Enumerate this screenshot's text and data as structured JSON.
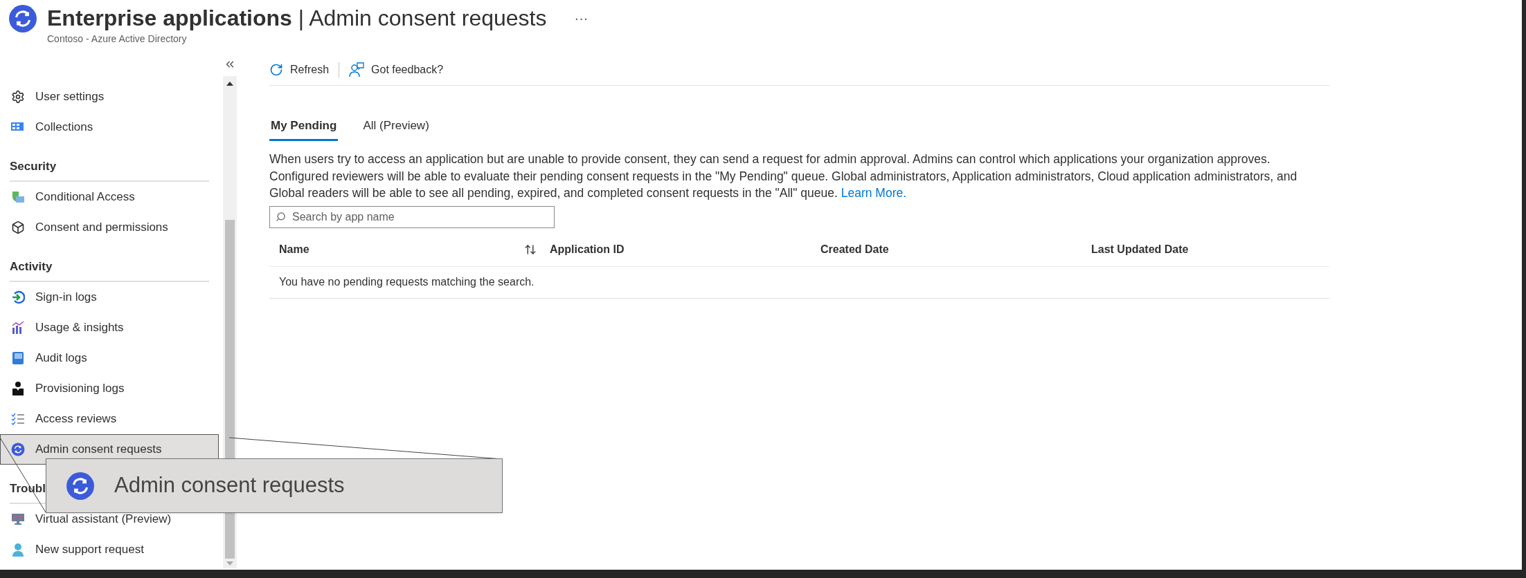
{
  "header": {
    "title": "Enterprise applications",
    "separator": "|",
    "page": "Admin consent requests",
    "org": "Contoso - Azure Active Directory",
    "more": "···"
  },
  "sidebar": {
    "sections": [
      {
        "items": [
          {
            "label": "User settings",
            "selected": false
          },
          {
            "label": "Collections",
            "selected": false
          }
        ]
      },
      {
        "heading": "Security",
        "items": [
          {
            "label": "Conditional Access",
            "selected": false
          },
          {
            "label": "Consent and permissions",
            "selected": false
          }
        ]
      },
      {
        "heading": "Activity",
        "items": [
          {
            "label": "Sign-in logs",
            "selected": false
          },
          {
            "label": "Usage & insights",
            "selected": false
          },
          {
            "label": "Audit logs",
            "selected": false
          },
          {
            "label": "Provisioning logs",
            "selected": false
          },
          {
            "label": "Access reviews",
            "selected": false
          },
          {
            "label": "Admin consent requests",
            "selected": true
          }
        ]
      },
      {
        "heading": "Troubl",
        "items": [
          {
            "label": "Virtual assistant (Preview)",
            "selected": false
          },
          {
            "label": "New support request",
            "selected": false
          }
        ]
      }
    ]
  },
  "zoom_callout": {
    "label": "Admin consent requests"
  },
  "toolbar": [
    {
      "label": "Refresh"
    },
    {
      "label": "Got feedback?"
    }
  ],
  "tabs": [
    {
      "label": "My Pending",
      "selected": true
    },
    {
      "label": "All (Preview)",
      "selected": false
    }
  ],
  "description": {
    "text": "When users try to access an application but are unable to provide consent, they can send a request for admin approval. Admins can control which applications your organization approves. Configured reviewers will be able to evaluate their pending consent requests in the \"My Pending\" queue. Global administrators, Application administrators, Cloud application administrators, and Global readers will be able to see all pending, expired, and completed consent requests in the \"All\" queue.",
    "link": "Learn More."
  },
  "search": {
    "placeholder": "Search by app name"
  },
  "table": {
    "columns": [
      {
        "label": "Name",
        "sortable": true
      },
      {
        "label": "Application ID",
        "sortable": false
      },
      {
        "label": "Created Date",
        "sortable": false
      },
      {
        "label": "Last Updated Date",
        "sortable": false
      }
    ],
    "empty_message": "You have no pending requests matching the search."
  }
}
